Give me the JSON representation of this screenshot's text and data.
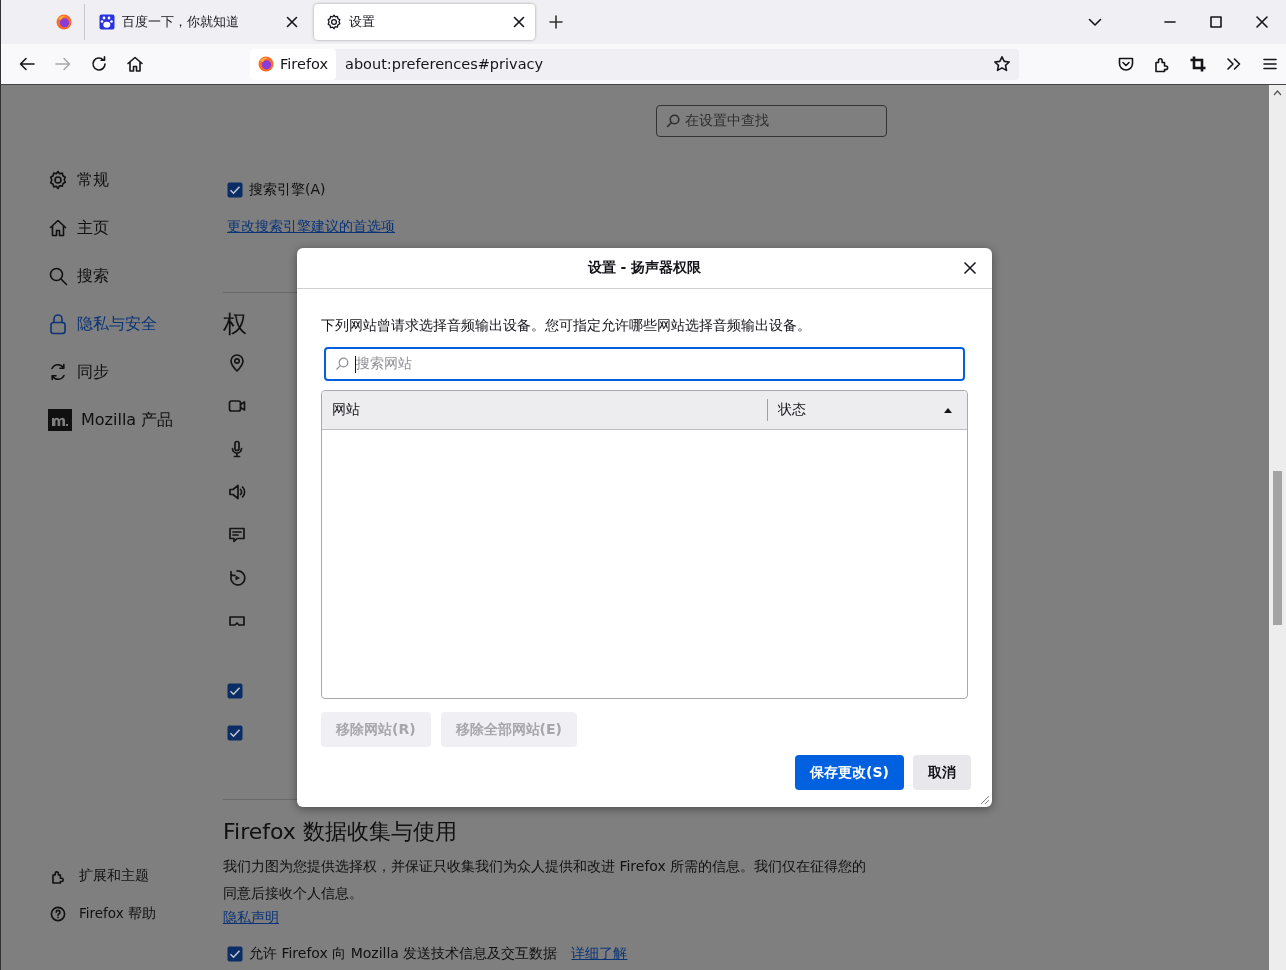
{
  "tabs": [
    {
      "kind": "pinned",
      "selected": false
    },
    {
      "kind": "site",
      "label": "百度一下，你就知道",
      "selected": false
    },
    {
      "kind": "settings",
      "label": "设置",
      "selected": true
    }
  ],
  "address_bar": {
    "identity": "Firefox",
    "url": "about:preferences#privacy"
  },
  "settings_search": {
    "placeholder": "在设置中查找"
  },
  "sidebar": {
    "items": [
      {
        "kind": "gear",
        "label": "常规",
        "selected": false
      },
      {
        "kind": "home",
        "label": "主页",
        "selected": false
      },
      {
        "kind": "search",
        "label": "搜索",
        "selected": false
      },
      {
        "kind": "lock",
        "label": "隐私与安全",
        "selected": true
      },
      {
        "kind": "sync",
        "label": "同步",
        "selected": false
      },
      {
        "kind": "mozilla",
        "label": "Mozilla 产品",
        "selected": false
      }
    ],
    "footer": [
      {
        "kind": "puzzle",
        "label": "扩展和主题"
      },
      {
        "kind": "help",
        "label": "Firefox 帮助"
      }
    ]
  },
  "main": {
    "search_engine_option": {
      "label": "搜索引擎(A)",
      "checked": true
    },
    "suggestion_link": "更改搜索引擎建议的首选项",
    "permissions_heading": "权",
    "hidden_options": [
      {
        "checked": true
      },
      {
        "checked": true
      }
    ],
    "data_collection": {
      "heading": "Firefox 数据收集与使用",
      "body": "我们力图为您提供选择权，并保证只收集我们为众人提供和改进 Firefox 所需的信息。我们仅在征得您的同意后接收个人信息。",
      "privacy_link": "隐私声明",
      "telemetry": {
        "label": "允许 Firefox 向 Mozilla 发送技术信息及交互数据",
        "checked": true,
        "link": "详细了解"
      }
    }
  },
  "dialog": {
    "title": "设置 - 扬声器权限",
    "description": "下列网站曾请求选择音频输出设备。您可指定允许哪些网站选择音频输出设备。",
    "search": {
      "placeholder": "搜索网站"
    },
    "columns": [
      {
        "label": "网站",
        "sorted": false
      },
      {
        "label": "状态",
        "sorted": true
      }
    ],
    "list_buttons": [
      {
        "label": "移除网站(R)",
        "disabled": true
      },
      {
        "label": "移除全部网站(E)",
        "disabled": true
      }
    ],
    "footer_buttons": [
      {
        "label": "保存更改(S)",
        "kind": "primary"
      },
      {
        "label": "取消",
        "kind": "secondary"
      }
    ]
  }
}
